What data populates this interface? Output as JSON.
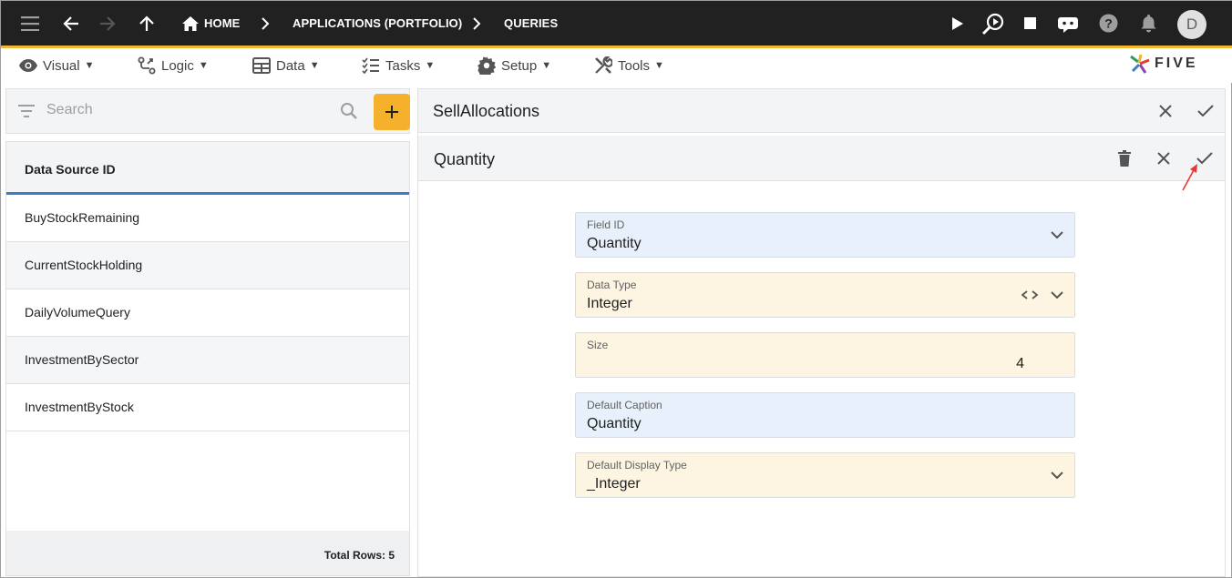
{
  "topbar": {
    "breadcrumbs": [
      "HOME",
      "APPLICATIONS (PORTFOLIO)",
      "QUERIES"
    ],
    "avatar_initial": "D"
  },
  "menu": {
    "items": [
      {
        "label": "Visual",
        "icon": "eye-icon"
      },
      {
        "label": "Logic",
        "icon": "logic-icon"
      },
      {
        "label": "Data",
        "icon": "table-icon"
      },
      {
        "label": "Tasks",
        "icon": "tasks-icon"
      },
      {
        "label": "Setup",
        "icon": "gear-icon"
      },
      {
        "label": "Tools",
        "icon": "tools-icon"
      }
    ],
    "caret": "▼",
    "logo_text": "FIVE"
  },
  "left": {
    "search_placeholder": "Search",
    "column_header": "Data Source ID",
    "rows": [
      "BuyStockRemaining",
      "CurrentStockHolding",
      "DailyVolumeQuery",
      "InvestmentBySector",
      "InvestmentByStock"
    ],
    "footer": "Total Rows: 5"
  },
  "right": {
    "title": "SellAllocations",
    "subtitle": "Quantity",
    "fields": [
      {
        "label": "Field ID",
        "value": "Quantity"
      },
      {
        "label": "Data Type",
        "value": "Integer"
      },
      {
        "label": "Size",
        "value": "4"
      },
      {
        "label": "Default Caption",
        "value": "Quantity"
      },
      {
        "label": "Default Display Type",
        "value": "_Integer"
      }
    ]
  },
  "colors": {
    "topbar": "#212121",
    "accent": "#f5b12b",
    "selection_line": "#3f7cc8",
    "field_blue": "#e8f1fb",
    "field_yellow": "#fdf5e2",
    "annotation_arrow": "#e53935"
  }
}
